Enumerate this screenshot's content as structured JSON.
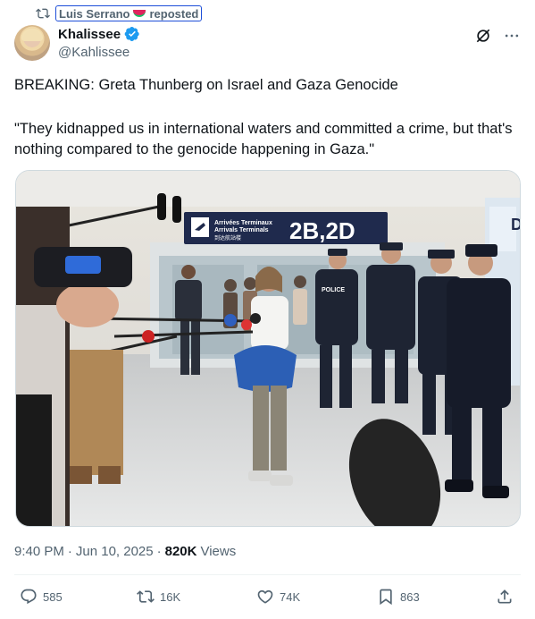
{
  "repost": {
    "reposter": "Luis Serrano",
    "label": "reposted",
    "icon": "retweet-icon"
  },
  "author": {
    "display_name": "Khalissee",
    "handle": "@Kahlissee",
    "verified": true,
    "avatar_icon": "avatar"
  },
  "tweet": {
    "headline": "BREAKING: Greta Thunberg on Israel and Gaza Genocide",
    "quote": "\"They kidnapped us in international waters and committed a crime, but that's nothing compared to the genocide happening in Gaza.\""
  },
  "media": {
    "sign_line1": "Arrivées Terminaux",
    "sign_line2": "Arrivals Terminals",
    "sign_line3": "到达航站楼",
    "sign_terminals": "2B,2D",
    "right_sign_letter": "D",
    "police_label": "POLICE"
  },
  "meta": {
    "time": "9:40 PM",
    "sep1": "·",
    "date": "Jun 10, 2025",
    "sep2": "·",
    "views_count": "820K",
    "views_label": "Views"
  },
  "actions": {
    "replies": "585",
    "reposts": "16K",
    "likes": "74K",
    "bookmarks": "863"
  },
  "colors": {
    "text": "#0f1419",
    "muted": "#536471",
    "verified_blue": "#1d9bf0",
    "repost_box": "#1d4ed8"
  }
}
